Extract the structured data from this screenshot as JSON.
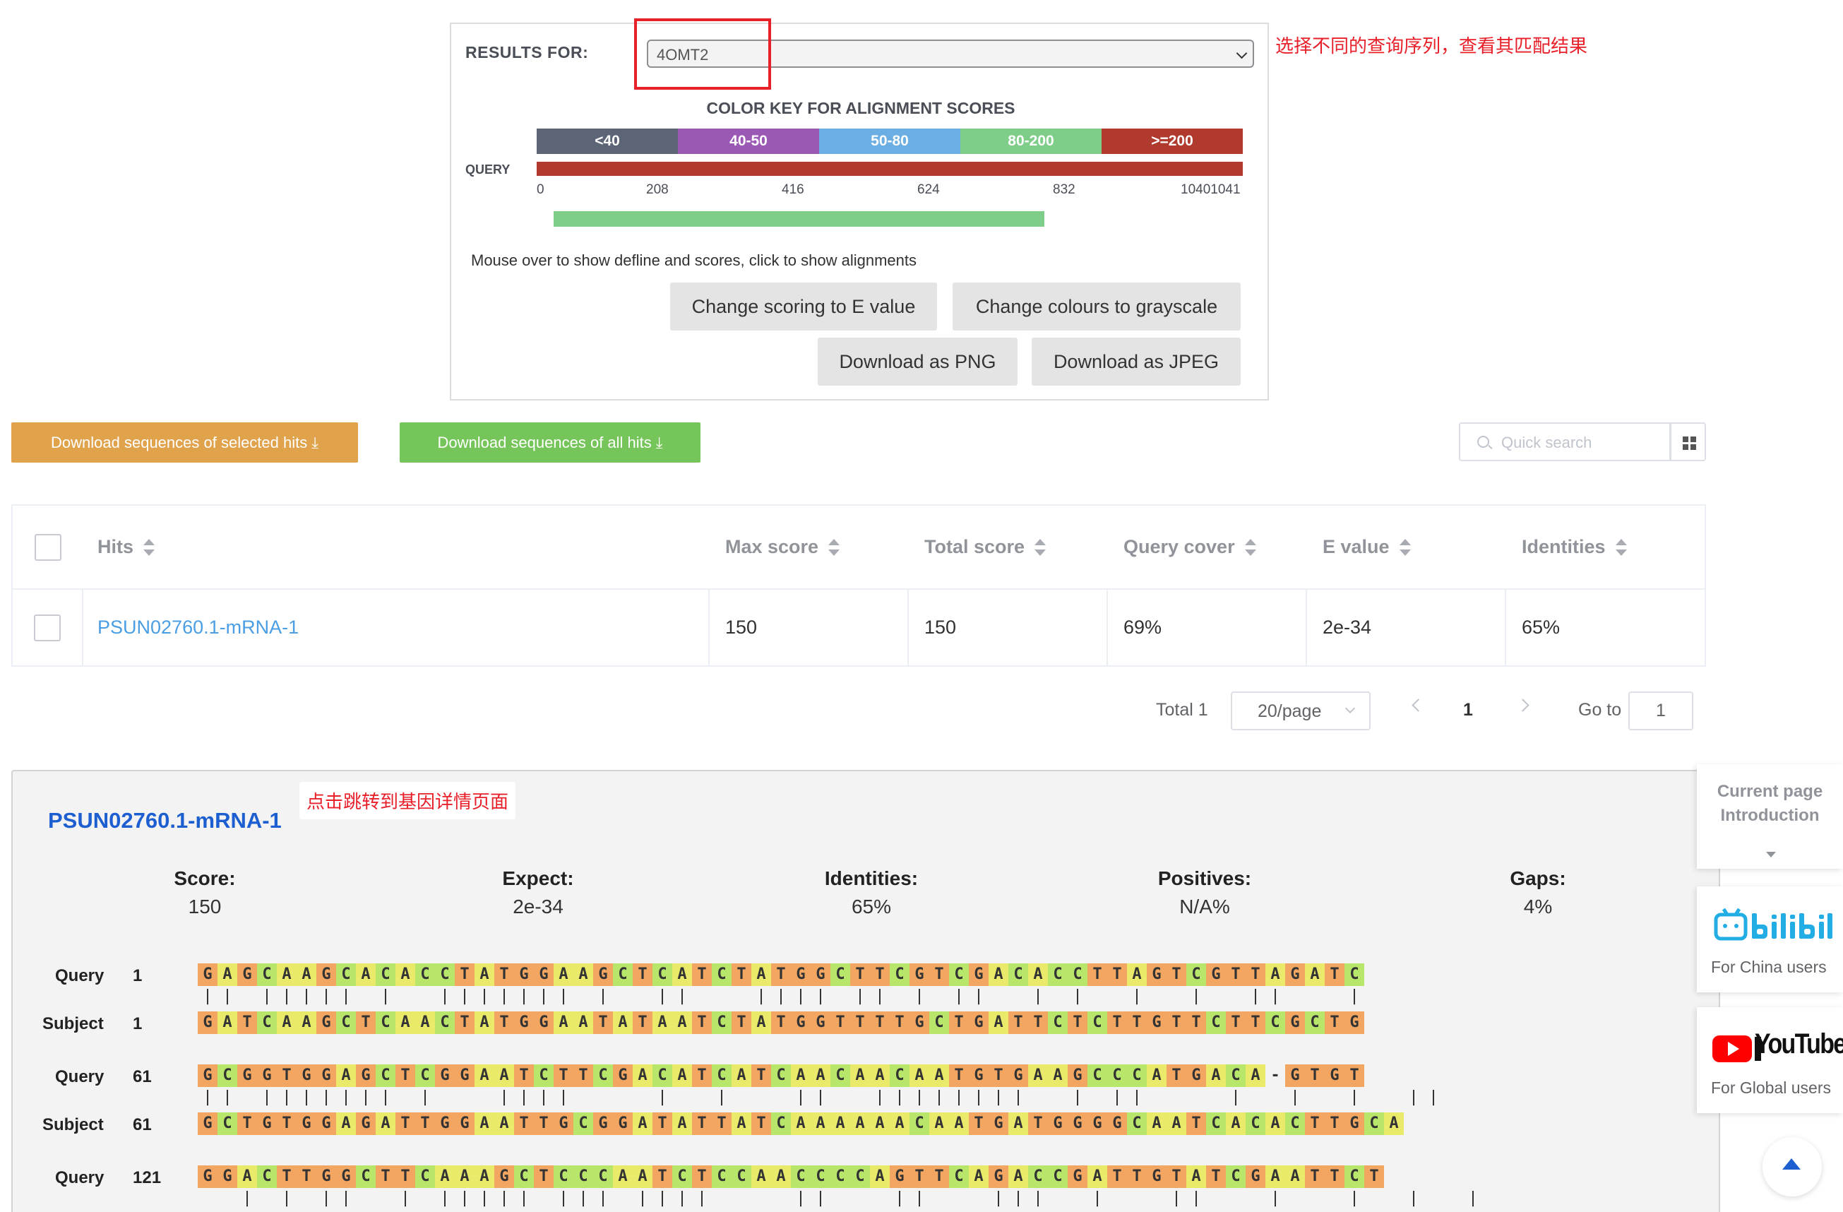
{
  "summary": {
    "results_label": "RESULTS FOR:",
    "selected_query": "4OMT2",
    "annotation_select": "选择不同的查询序列，查看其匹配结果",
    "color_key_title": "COLOR KEY FOR ALIGNMENT SCORES",
    "color_key": [
      {
        "label": "<40",
        "color": "#5b6575"
      },
      {
        "label": "40-50",
        "color": "#9b59b6"
      },
      {
        "label": "50-80",
        "color": "#6aaee3"
      },
      {
        "label": "80-200",
        "color": "#7ece8a"
      },
      {
        "label": ">=200",
        "color": "#b03a2e"
      }
    ],
    "query_label": "QUERY",
    "ticks": [
      "0",
      "208",
      "416",
      "624",
      "832",
      "10401041"
    ],
    "mouse_hint": "Mouse over to show defline and scores, click to show alignments",
    "buttons": {
      "scoring": "Change scoring to E value",
      "grayscale": "Change colours to grayscale",
      "png": "Download as PNG",
      "jpeg": "Download as JPEG"
    }
  },
  "toolbar": {
    "download_selected": "Download sequences of selected hits",
    "download_all": "Download sequences of all hits",
    "download_selected_color": "#e0a24a",
    "download_all_color": "#76c55a",
    "search_placeholder": "Quick search"
  },
  "table": {
    "headers": [
      "Hits",
      "Max score",
      "Total score",
      "Query cover",
      "E value",
      "Identities"
    ],
    "rows": [
      {
        "hit": "PSUN02760.1-mRNA-1",
        "max_score": "150",
        "total_score": "150",
        "query_cover": "69%",
        "e_value": "2e-34",
        "identities": "65%"
      }
    ]
  },
  "pagination": {
    "total": "Total 1",
    "page_size": "20/page",
    "current_page": "1",
    "goto_label": "Go to",
    "goto_value": "1"
  },
  "detail": {
    "title": "PSUN02760.1-mRNA-1",
    "annotation_link": "点击跳转到基因详情页面",
    "stats": [
      {
        "label": "Score:",
        "value": "150"
      },
      {
        "label": "Expect:",
        "value": "2e-34"
      },
      {
        "label": "Identities:",
        "value": "65%"
      },
      {
        "label": "Positives:",
        "value": "N/A%"
      },
      {
        "label": "Gaps:",
        "value": "4%"
      }
    ],
    "blocks": [
      {
        "query_label": "Query",
        "query_start": "1",
        "query_seq": "GAGCAAGCACACCTATGGAAGCTCATCTATGGCTTCGTCGACACCTTAGTCGTTAGATC",
        "match": "|| ||||| |  ||||||| |  ||   |||| || | ||  | |  |  |  ||   |",
        "subject_label": "Subject",
        "subject_start": "1",
        "subject_seq": "GATCAAGCTCAACTATGGAATATAATCTATGGTTTTGCTGATTCTCTTGTTCTTCGCTG"
      },
      {
        "query_label": "Query",
        "query_start": "61",
        "query_seq": "GCGGTGGAGCTCGGAATCTTCGACATCATCAACAACAATGTGAAGCCCATGACA-GTGT",
        "match": "|| ||||||| |   ||||    |  |   ||  ||||||||  | ||    |  |  |  ||",
        "subject_label": "Subject",
        "subject_start": "61",
        "subject_seq": "GCTGTGGAGATTGGAATTGCGGATATTATCAAAAAACAATGATGGGGCAATCACACTTGCA"
      },
      {
        "query_label": "Query",
        "query_start": "121",
        "query_seq": "GGACTTGGCTTCAAAGCTCCCAATCTCCAACCCCAGTTCAGACCGATTGTATCGAATTCT",
        "match": "  | | ||  | ||||| ||| ||||    ||   ||   |||  |   ||   |   |  |  |"
      }
    ]
  },
  "side": {
    "intro_line1": "Current page",
    "intro_line2": "Introduction",
    "china_caption": "For China users",
    "global_caption": "For Global users",
    "bili_color": "#23ade5",
    "youtube_red": "#ff0000"
  }
}
